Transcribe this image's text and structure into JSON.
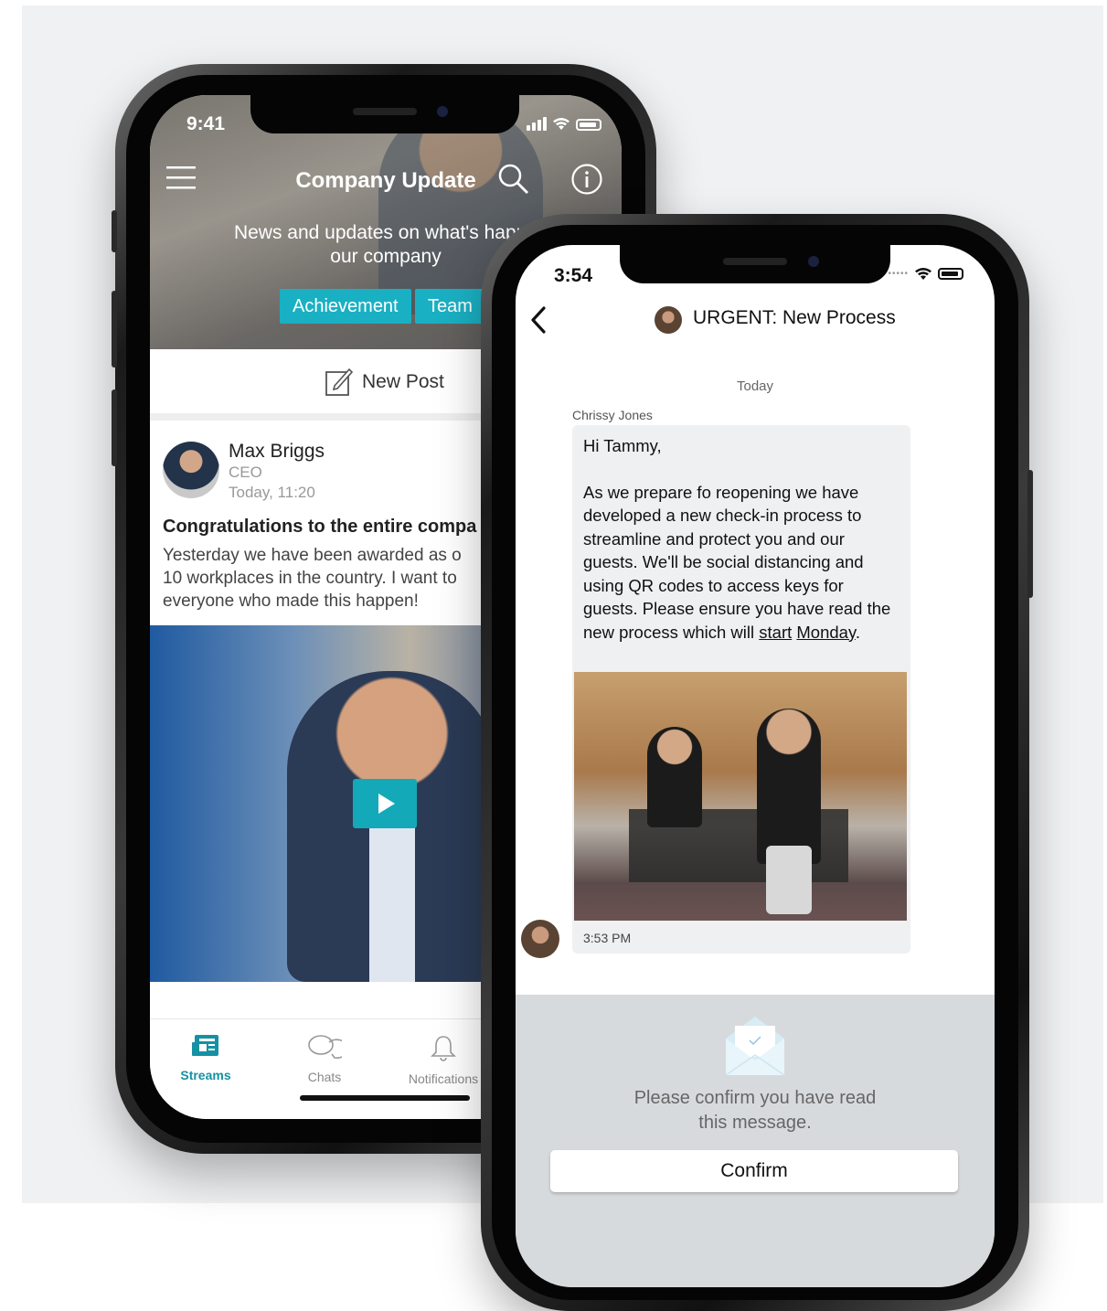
{
  "colors": {
    "accent": "#1ab0c3",
    "active_tab": "#1591a3",
    "background": "#f0f1f3",
    "confirm_panel": "#d7dadd"
  },
  "phone1": {
    "status_time": "9:41",
    "header": {
      "title": "Company Update",
      "subtitle_line1": "News and updates on what's happe",
      "subtitle_line2": "our company",
      "menu_icon": "hamburger-icon",
      "search_icon": "search-icon",
      "info_icon": "info-icon"
    },
    "tags": [
      "Achievement",
      "Team"
    ],
    "new_post": {
      "label": "New Post",
      "icon": "compose-icon"
    },
    "post": {
      "author": "Max Briggs",
      "role": "CEO",
      "time": "Today, 11:20",
      "title": "Congratulations to the entire compa",
      "body_line1": "Yesterday we have been awarded as o",
      "body_line2": "10 workplaces in the country. I want to",
      "body_line3": "everyone who made this happen!"
    },
    "tabbar": [
      {
        "label": "Streams",
        "icon": "news-icon"
      },
      {
        "label": "Chats",
        "icon": "chat-bubbles-icon"
      },
      {
        "label": "Notifications",
        "icon": "bell-icon"
      }
    ]
  },
  "phone2": {
    "status_time": "3:54",
    "chat_title": "URGENT: New Process",
    "date_separator": "Today",
    "sender": "Chrissy Jones",
    "message": {
      "greeting": "Hi Tammy,",
      "body": "As we prepare fo reopening we have developed a new check-in process to streamline and protect you and our guests. We'll be social distancing and using QR codes to access keys for guests. Please ensure you have read the new process which will",
      "link_start": "start",
      "link_monday": "Monday",
      "period": "."
    },
    "message_time": "3:53 PM",
    "confirm": {
      "prompt_line1": "Please confirm you have read",
      "prompt_line2": "this message.",
      "button": "Confirm",
      "icon": "envelope-check-icon"
    }
  }
}
